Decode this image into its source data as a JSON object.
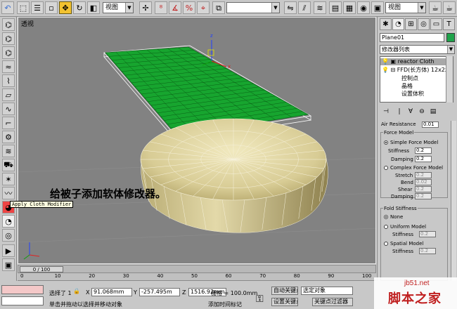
{
  "toolbar": {
    "view_dropdown": "视图",
    "view_dropdown2": "视图"
  },
  "viewport": {
    "label": "透视",
    "caption": "给被子添加软体修改器。",
    "tooltip": "Apply Cloth Modifier"
  },
  "panel": {
    "object_name": "Plane01",
    "object_color": "#1ea34a",
    "modifier_list": "修改器列表",
    "stack": [
      "reactor Cloth",
      "FFD(长方体) 12x2x",
      "控制点",
      "晶格",
      "设置体积"
    ],
    "rollout": {
      "air_resistance_label": "Air Resistance",
      "air_resistance_value": "0.01",
      "force_model_title": "Force Model",
      "simple_force_model": "Simple Force Model",
      "stiffness_label": "Stiffness",
      "stiffness_value": "0.2",
      "damping_label": "Damping",
      "damping_value": "0.2",
      "complex_force_model": "Complex Force Model",
      "stretch_label": "Stretch",
      "stretch_value": "0.2",
      "bend_label": "Bend",
      "bend_value": "0.02",
      "shear_label": "Shear",
      "shear_value": "0.2",
      "damping2_label": "Damping",
      "damping2_value": "0.2",
      "fold_stiffness_title": "Fold Stiffness",
      "none_label": "None",
      "uniform_model": "Uniform Model",
      "uniform_stiffness_label": "Stiffness",
      "uniform_stiffness_value": "0.2",
      "spatial_model": "Spatial Model",
      "spatial_stiffness_label": "Stiffness",
      "spatial_stiffness_value": "0.2"
    }
  },
  "timeline": {
    "frame_readout": "0 / 100",
    "ticks": [
      "0",
      "10",
      "20",
      "30",
      "40",
      "50",
      "60",
      "70",
      "80",
      "90",
      "100"
    ],
    "frame_progress": 0.0
  },
  "status": {
    "selected_text": "选择了 1",
    "x_label": "X",
    "x_value": "91.068mm",
    "y_label": "Y",
    "y_value": "-257.495m",
    "z_label": "Z",
    "z_value": "1516.92mm",
    "grid_text": "栅格 = 100.0mm",
    "auto_key": "自动关键点",
    "set_key": "设置关键点",
    "selection_set": "选定对象",
    "key_filters": "关键点过滤器",
    "prompt": "单击并拖动以选择并移动对象",
    "add_time_tag": "添加时间标记"
  },
  "watermark": {
    "site": "jb51.net",
    "name": "脚本之家"
  }
}
